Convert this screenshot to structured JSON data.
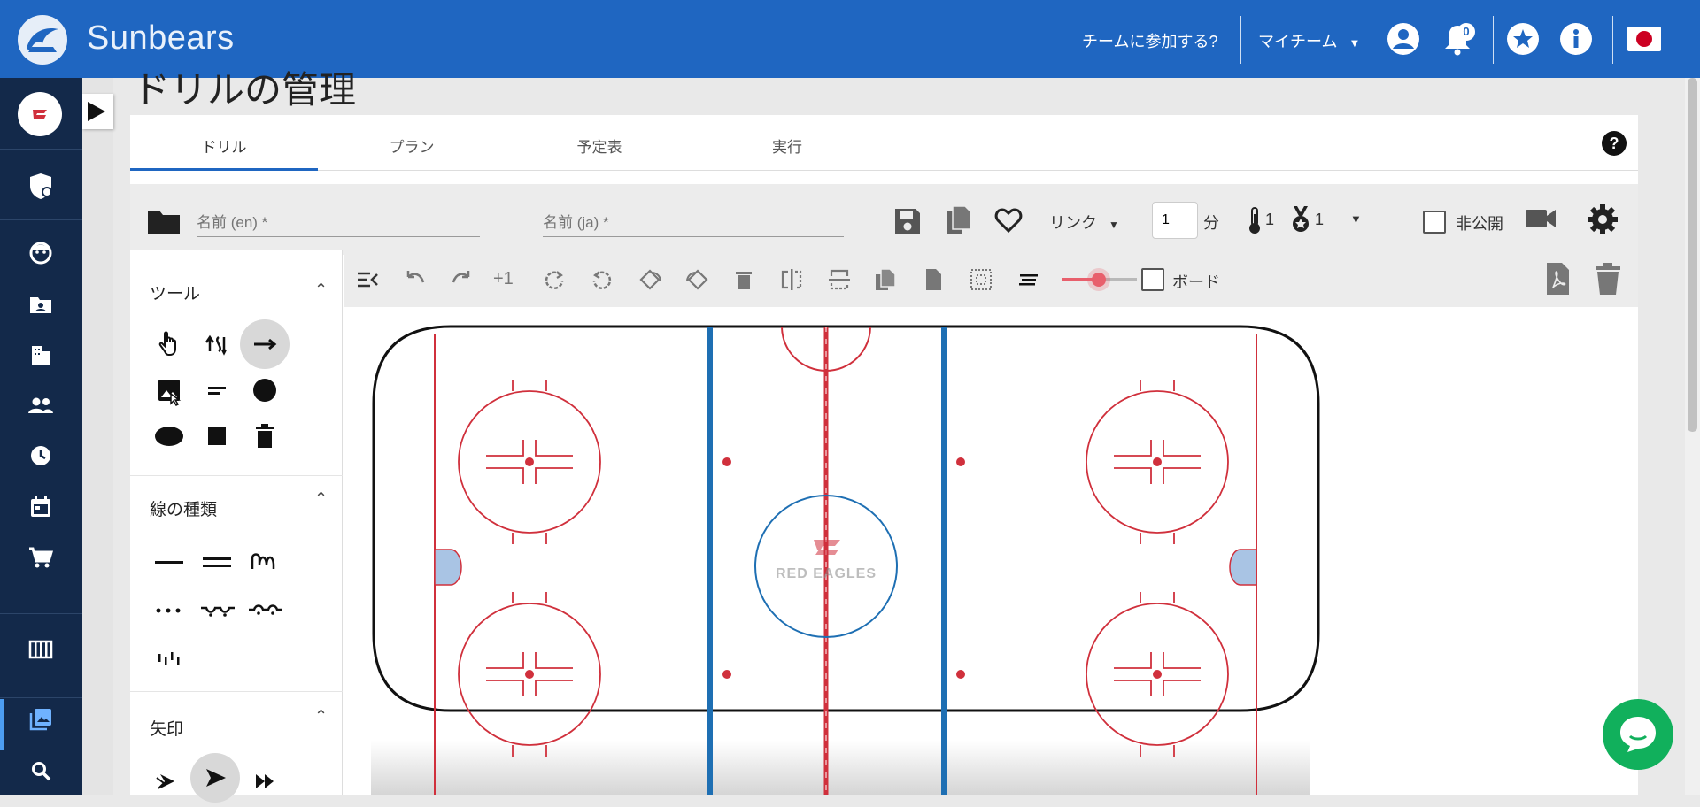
{
  "header": {
    "brand": "Sunbears",
    "join_team": "チームに参加する?",
    "my_team": "マイチーム",
    "notification_count": "0"
  },
  "page": {
    "title": "ドリルの管理"
  },
  "tabs": [
    {
      "label": "ドリル"
    },
    {
      "label": "プラン"
    },
    {
      "label": "予定表"
    },
    {
      "label": "実行"
    }
  ],
  "drill_form": {
    "name_en_placeholder": "名前 (en) *",
    "name_ja_placeholder": "名前 (ja) *",
    "link_label": "リンク",
    "duration_value": "1",
    "duration_unit": "分",
    "intensity_value": "1",
    "level_value": "1",
    "private_label": "非公開"
  },
  "canvas_toolbar": {
    "plus_one_label": "+1",
    "board_label": "ボード"
  },
  "tool_panel": {
    "tools_title": "ツール",
    "line_types_title": "線の種類",
    "arrows_title": "矢印"
  },
  "colors": {
    "header_blue": "#1f66c1",
    "sidebar_navy": "#13294a",
    "rink_red": "#d0303c",
    "rink_blue": "#1e6fb3",
    "chat_green": "#11b05c"
  }
}
